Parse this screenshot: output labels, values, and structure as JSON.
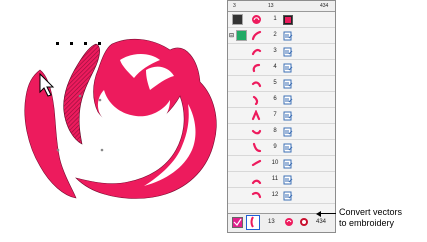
{
  "colors": {
    "rose": "#ed1b5d",
    "hatch": "#b01249",
    "selection": "#4a7fd4"
  },
  "header": {
    "col1": "3",
    "col2": "13",
    "col3": "434"
  },
  "rows": [
    {
      "num": "1",
      "icon": "color-swatch-icon"
    },
    {
      "num": "2",
      "icon": "vector-object-icon"
    },
    {
      "num": "3",
      "icon": "vector-object-icon"
    },
    {
      "num": "4",
      "icon": "vector-object-icon"
    },
    {
      "num": "5",
      "icon": "vector-object-icon"
    },
    {
      "num": "6",
      "icon": "vector-object-icon"
    },
    {
      "num": "7",
      "icon": "vector-object-icon"
    },
    {
      "num": "8",
      "icon": "vector-object-icon"
    },
    {
      "num": "9",
      "icon": "vector-object-icon"
    },
    {
      "num": "10",
      "icon": "vector-object-icon"
    },
    {
      "num": "11",
      "icon": "vector-object-icon"
    },
    {
      "num": "12",
      "icon": "vector-object-icon"
    }
  ],
  "footer": {
    "count": "13",
    "total": "434"
  },
  "callout": {
    "line1": "Convert vectors",
    "line2": "to embroidery"
  }
}
